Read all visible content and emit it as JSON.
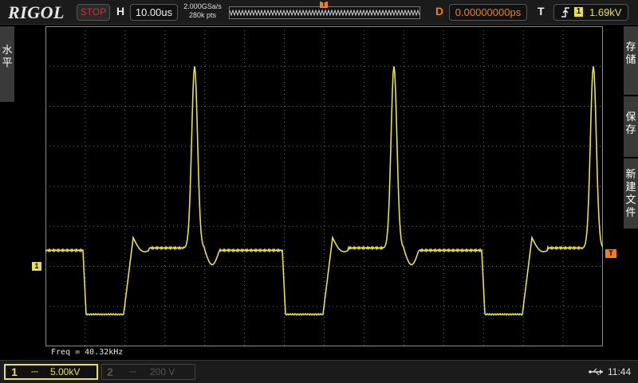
{
  "topbar": {
    "logo": "RIGOL",
    "run_state": "STOP",
    "horizontal_label": "H",
    "timebase": "10.00us",
    "sample_rate": "2.000GSa/s",
    "memory_depth": "280k pts",
    "trigger_marker": "T",
    "delay_label": "D",
    "delay_value": "0.00000000ps",
    "trigger_label": "T",
    "trigger_source": "1",
    "trigger_level": "1.69kV"
  },
  "left_tab": {
    "label": "水\n平"
  },
  "right_tabs": [
    {
      "label": "存\n储"
    },
    {
      "label": "保\n存"
    },
    {
      "label": "新\n建\n文\n件"
    }
  ],
  "markers": {
    "ch1": "1",
    "trigger_level": "T"
  },
  "measurement": {
    "freq": "Freq = 40.32kHz"
  },
  "channels": [
    {
      "num": "1",
      "coupling": "⎓",
      "scale": "5.00kV",
      "color": "#e6e04a"
    },
    {
      "num": "2",
      "coupling": "⎓",
      "scale": "200 V",
      "color": "#555555"
    }
  ],
  "status": {
    "time": "11:44"
  },
  "colors": {
    "ch1": "#e6e04a",
    "trigger": "#f07f18",
    "grid": "#8a8a8a"
  },
  "icons": {
    "trigger_edge": "rising-edge-icon",
    "usb": "usb-icon"
  },
  "waveform": {
    "period_us": 24.8,
    "baseline_div": -1.6,
    "low_div": -3.2,
    "peak_div": 3.0
  }
}
